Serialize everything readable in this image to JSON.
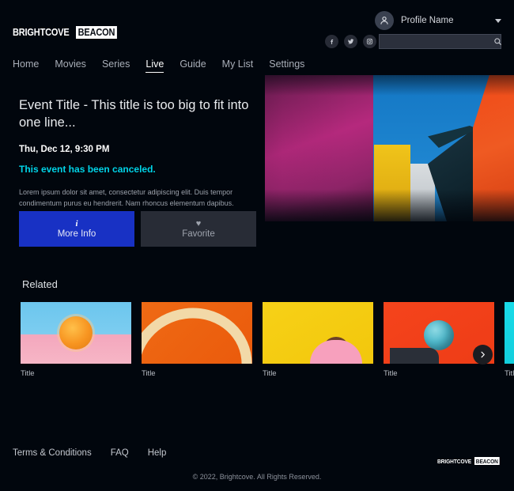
{
  "brand": {
    "primary_word": "BRIGHTCOVE",
    "secondary_word": "BEACON"
  },
  "header": {
    "profile": {
      "name": "Profile Name",
      "avatar_icon": "user-icon",
      "caret_icon": "chevron-down-icon"
    },
    "socials": [
      {
        "name": "facebook-icon",
        "glyph": "f"
      },
      {
        "name": "twitter-icon",
        "glyph": "t"
      },
      {
        "name": "instagram-icon",
        "glyph": "i"
      }
    ],
    "search": {
      "value": "",
      "placeholder": "",
      "icon": "search-icon"
    },
    "nav": [
      {
        "label": "Home",
        "active": false
      },
      {
        "label": "Movies",
        "active": false
      },
      {
        "label": "Series",
        "active": false
      },
      {
        "label": "Live",
        "active": true
      },
      {
        "label": "Guide",
        "active": false
      },
      {
        "label": "My List",
        "active": false
      },
      {
        "label": "Settings",
        "active": false
      }
    ]
  },
  "hero": {
    "title": "Event Title - This title is too big to fit into one line...",
    "date": "Thu, Dec 12, 9:30 PM",
    "status": "This event has been canceled.",
    "status_color": "#00d4e8",
    "description": "Lorem ipsum dolor sit amet, consectetur adipiscing elit. Duis tempor condimentum purus eu hendrerit. Nam rhoncus elementum dapibus. Aliquam sed...",
    "buttons": [
      {
        "label": "More Info",
        "icon": "info-icon",
        "glyph": "i",
        "style": "primary",
        "color": "#1831c4"
      },
      {
        "label": "Favorite",
        "icon": "heart-icon",
        "glyph": "♥",
        "style": "secondary",
        "color": "#282c36"
      }
    ]
  },
  "related": {
    "heading": "Related",
    "next_icon": "chevron-right-icon",
    "cards": [
      {
        "label": "Title",
        "thumb": "thumb1"
      },
      {
        "label": "Title",
        "thumb": "thumb2"
      },
      {
        "label": "Title",
        "thumb": "thumb3"
      },
      {
        "label": "Title",
        "thumb": "thumb4"
      },
      {
        "label": "Title",
        "thumb": "thumb5"
      }
    ]
  },
  "footer": {
    "links": [
      {
        "label": "Terms & Conditions"
      },
      {
        "label": "FAQ"
      },
      {
        "label": "Help"
      }
    ],
    "copyright": "© 2022, Brightcove. All Rights Reserved."
  }
}
